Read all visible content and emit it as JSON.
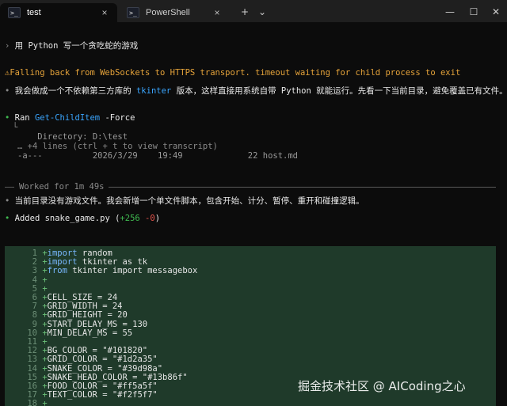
{
  "tabs": [
    {
      "label": "test",
      "icon": "terminal-icon",
      "glyph": ">_",
      "active": true
    },
    {
      "label": "PowerShell",
      "icon": "terminal-icon",
      "glyph": ">_",
      "active": false
    }
  ],
  "tabbar": {
    "close": "×",
    "new_tab": "+",
    "dropdown": "⌄",
    "minimize": "—",
    "maximize": "☐",
    "close_window": "✕"
  },
  "transcript": {
    "prompt_marker": "›",
    "prompt": "用 Python 写一个贪吃蛇的游戏",
    "warning_icon": "⚠",
    "warning": "Falling back from WebSockets to HTTPS transport. timeout waiting for child process to exit",
    "bullet": "•",
    "msg1_pre": "我会做成一个不依赖第三方库的 ",
    "msg1_tk": "tkinter",
    "msg1_post": " 版本，这样直接用系统自带 Python 就能运行。先看一下当前目录，避免覆盖已有文件。",
    "ran_label": "Ran ",
    "ran_cmd": "Get-ChildItem",
    "ran_args": " -Force",
    "tree": "└",
    "dir_line": "    Directory: D:\\test",
    "more_lines": "… +4 lines (ctrl + t to view transcript)",
    "file_row": "-a---          2026/3/29    19:49             22 host.md",
    "worked": "Worked for 1m 49s",
    "msg2": "当前目录没有游戏文件。我会新增一个单文件脚本，包含开始、计分、暂停、重开和碰撞逻辑。",
    "added_label": "Added snake_game.py (",
    "added_plus": "+256",
    "added_sep": " ",
    "added_minus": "-0",
    "added_close": ")"
  },
  "diff_lines": [
    {
      "n": "1",
      "kw": "import",
      "rest": " random"
    },
    {
      "n": "2",
      "kw": "import",
      "rest": " tkinter as tk"
    },
    {
      "n": "3",
      "kw": "from",
      "rest": " tkinter import messagebox"
    },
    {
      "n": "4",
      "kw": "",
      "rest": ""
    },
    {
      "n": "5",
      "kw": "",
      "rest": ""
    },
    {
      "n": "6",
      "kw": "",
      "rest": "CELL_SIZE = 24"
    },
    {
      "n": "7",
      "kw": "",
      "rest": "GRID_WIDTH = 24"
    },
    {
      "n": "8",
      "kw": "",
      "rest": "GRID_HEIGHT = 20"
    },
    {
      "n": "9",
      "kw": "",
      "rest": "START_DELAY_MS = 130"
    },
    {
      "n": "10",
      "kw": "",
      "rest": "MIN_DELAY_MS = 55"
    },
    {
      "n": "11",
      "kw": "",
      "rest": ""
    },
    {
      "n": "12",
      "kw": "",
      "rest": "BG_COLOR = \"#101820\""
    },
    {
      "n": "13",
      "kw": "",
      "rest": "GRID_COLOR = \"#1d2a35\""
    },
    {
      "n": "14",
      "kw": "",
      "rest": "SNAKE_COLOR = \"#39d98a\""
    },
    {
      "n": "15",
      "kw": "",
      "rest": "SNAKE_HEAD_COLOR = \"#13b86f\""
    },
    {
      "n": "16",
      "kw": "",
      "rest": "FOOD_COLOR = \"#ff5a5f\""
    },
    {
      "n": "17",
      "kw": "",
      "rest": "TEXT_COLOR = \"#f2f5f7\""
    },
    {
      "n": "18",
      "kw": "",
      "rest": ""
    }
  ],
  "watermark": "掘金技术社区 @ AICoding之心",
  "colors": {
    "background": "#0c0c0c",
    "diff_bg": "#1f3a2a",
    "warning": "#e5a33a",
    "accent": "#3aa6ff",
    "added": "#3fb950"
  }
}
